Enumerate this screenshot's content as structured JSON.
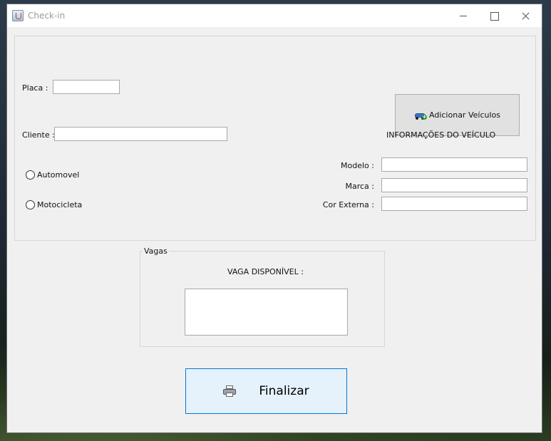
{
  "window": {
    "title": "Check-in"
  },
  "form": {
    "placa_label": "Placa :",
    "placa_value": "",
    "cliente_label": "Cliente :",
    "cliente_value": "",
    "radios": [
      {
        "label": "Automovel",
        "checked": false
      },
      {
        "label": "Motocicleta",
        "checked": false
      }
    ]
  },
  "vehicle": {
    "add_button_label": "Adicionar Veículos",
    "add_button_icon": "car-add-icon",
    "info_heading": "INFORMAÇÕES DO VEÍCULO",
    "modelo_label": "Modelo :",
    "modelo_value": "",
    "marca_label": "Marca :",
    "marca_value": "",
    "cor_label": "Cor Externa :",
    "cor_value": ""
  },
  "vagas": {
    "legend": "Vagas",
    "available_label": "VAGA DISPONÍVEL :",
    "available_value": ""
  },
  "actions": {
    "finish_label": "Finalizar",
    "finish_icon": "printer-icon"
  },
  "colors": {
    "window_bg": "#f0f0f0",
    "focus_border": "#0078d7",
    "focus_bg": "#e5f1fb"
  }
}
